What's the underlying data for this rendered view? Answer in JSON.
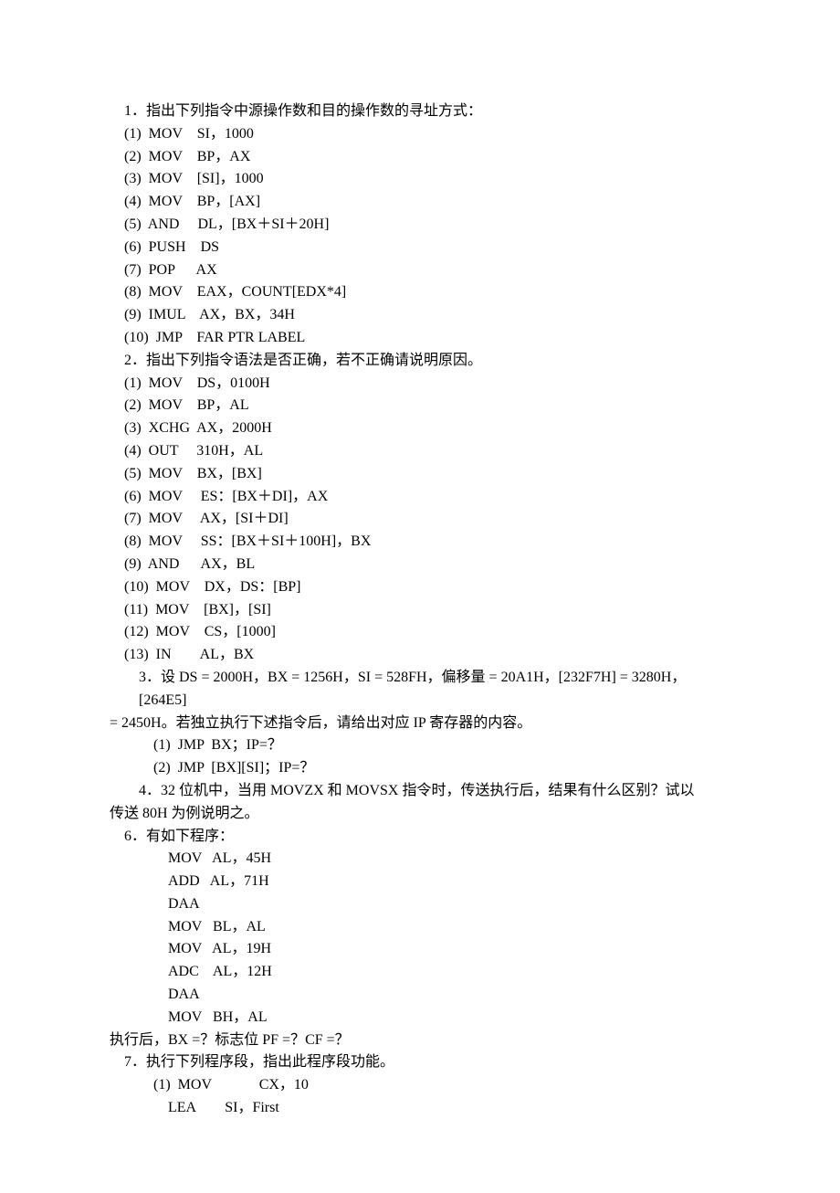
{
  "lines": [
    {
      "cls": "indent-small",
      "text": "1．指出下列指令中源操作数和目的操作数的寻址方式："
    },
    {
      "cls": "indent-small",
      "text": "(1)  MOV    SI，1000"
    },
    {
      "cls": "indent-small",
      "text": "(2)  MOV    BP，AX"
    },
    {
      "cls": "indent-small",
      "text": "(3)  MOV    [SI]，1000"
    },
    {
      "cls": "indent-small",
      "text": "(4)  MOV    BP，[AX]"
    },
    {
      "cls": "indent-small",
      "text": "(5)  AND     DL，[BX＋SI＋20H]"
    },
    {
      "cls": "indent-small",
      "text": "(6)  PUSH    DS"
    },
    {
      "cls": "indent-small",
      "text": "(7)  POP      AX"
    },
    {
      "cls": "indent-small",
      "text": "(8)  MOV    EAX，COUNT[EDX*4]"
    },
    {
      "cls": "indent-small",
      "text": "(9)  IMUL    AX，BX，34H"
    },
    {
      "cls": "indent-small",
      "text": "(10)  JMP    FAR PTR LABEL"
    },
    {
      "cls": "indent-small",
      "text": "2．指出下列指令语法是否正确，若不正确请说明原因。"
    },
    {
      "cls": "indent-small",
      "text": "(1)  MOV    DS，0100H"
    },
    {
      "cls": "indent-small",
      "text": "(2)  MOV    BP，AL"
    },
    {
      "cls": "indent-small",
      "text": "(3)  XCHG  AX，2000H"
    },
    {
      "cls": "indent-small",
      "text": "(4)  OUT     310H，AL"
    },
    {
      "cls": "indent-small",
      "text": "(5)  MOV    BX，[BX]"
    },
    {
      "cls": "indent-small",
      "text": "(6)  MOV     ES：[BX＋DI]，AX"
    },
    {
      "cls": "indent-small",
      "text": "(7)  MOV     AX，[SI＋DI]"
    },
    {
      "cls": "indent-small",
      "text": "(8)  MOV     SS：[BX＋SI＋100H]，BX"
    },
    {
      "cls": "indent-small",
      "text": "(9)  AND      AX，BL"
    },
    {
      "cls": "indent-small",
      "text": "(10)  MOV    DX，DS：[BP]"
    },
    {
      "cls": "indent-small",
      "text": "(11)  MOV    [BX]，[SI]"
    },
    {
      "cls": "indent-small",
      "text": "(12)  MOV    CS，[1000]"
    },
    {
      "cls": "indent-small",
      "text": "(13)  IN        AL，BX"
    },
    {
      "cls": "indent1",
      "text": "3．设 DS = 2000H，BX = 1256H，SI = 528FH，偏移量 = 20A1H，[232F7H] = 3280H，[264E5]"
    },
    {
      "cls": "noind",
      "text": "= 2450H。若独立执行下述指令后，请给出对应 IP 寄存器的内容。"
    },
    {
      "cls": "indent2",
      "text": "(1)  JMP  BX；IP=？"
    },
    {
      "cls": "indent2",
      "text": "(2)  JMP  [BX][SI]；IP=？"
    },
    {
      "cls": "indent1",
      "text": "4．32 位机中，当用 MOVZX 和 MOVSX 指令时，传送执行后，结果有什么区别？试以"
    },
    {
      "cls": "noind",
      "text": "传送 80H 为例说明之。"
    },
    {
      "cls": "indent-small",
      "text": "6．有如下程序："
    },
    {
      "cls": "indent3",
      "text": "MOV   AL，45H"
    },
    {
      "cls": "indent3",
      "text": "ADD   AL，71H"
    },
    {
      "cls": "indent3",
      "text": "DAA"
    },
    {
      "cls": "indent3",
      "text": "MOV   BL，AL"
    },
    {
      "cls": "indent3",
      "text": "MOV   AL，19H"
    },
    {
      "cls": "indent3",
      "text": "ADC    AL，12H"
    },
    {
      "cls": "indent3",
      "text": "DAA"
    },
    {
      "cls": "indent3",
      "text": "MOV   BH，AL"
    },
    {
      "cls": "noind",
      "text": "执行后，BX =？标志位 PF =？CF =？"
    },
    {
      "cls": "indent-small",
      "text": "7．执行下列程序段，指出此程序段功能。"
    },
    {
      "cls": "indent2",
      "text": "(1)  MOV             CX，10"
    },
    {
      "cls": "indent3",
      "text": "LEA        SI，First"
    }
  ]
}
